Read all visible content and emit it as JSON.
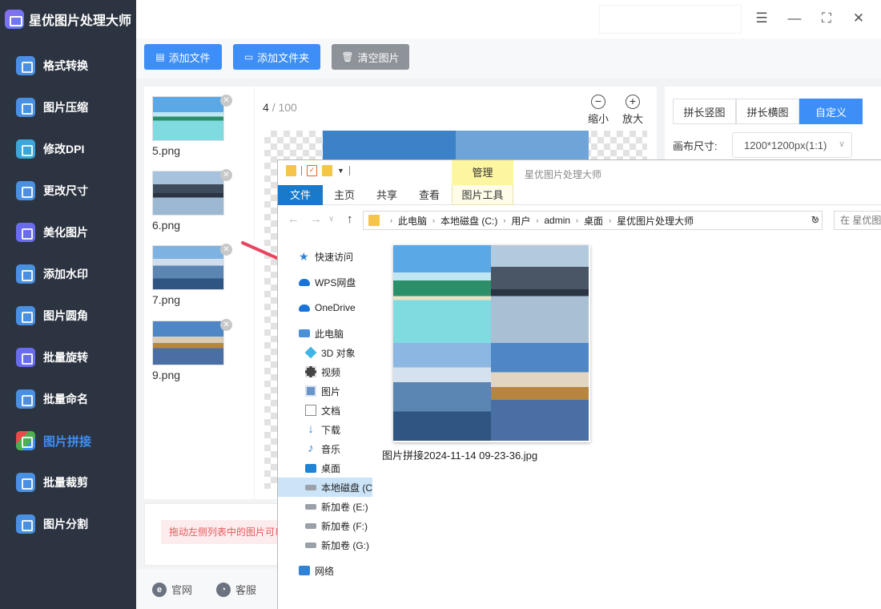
{
  "app": {
    "title": "星优图片处理大师"
  },
  "sidebar": {
    "items": [
      {
        "label": "格式转换"
      },
      {
        "label": "图片压缩"
      },
      {
        "label": "修改DPI"
      },
      {
        "label": "更改尺寸"
      },
      {
        "label": "美化图片"
      },
      {
        "label": "添加水印"
      },
      {
        "label": "图片圆角"
      },
      {
        "label": "批量旋转"
      },
      {
        "label": "批量命名"
      },
      {
        "label": "图片拼接"
      },
      {
        "label": "批量裁剪"
      },
      {
        "label": "图片分割"
      }
    ],
    "active_item": "图片拼接"
  },
  "toolbar": {
    "add_file": "添加文件",
    "add_folder": "添加文件夹",
    "clear": "清空图片"
  },
  "file_list": [
    {
      "name": "5.png"
    },
    {
      "name": "6.png"
    },
    {
      "name": "7.png"
    },
    {
      "name": "9.png"
    }
  ],
  "preview": {
    "current": "4",
    "separator": "/",
    "total": "100",
    "zoom_out": "缩小",
    "zoom_in": "放大"
  },
  "settings": {
    "tabs": [
      "拼长竖图",
      "拼长横图",
      "自定义"
    ],
    "active_tab": "自定义",
    "canvas_label": "画布尺寸:",
    "canvas_value": "1200*1200px(1:1)"
  },
  "hint": {
    "text": "拖动左侧列表中的图片可以"
  },
  "footer": {
    "website": "官网",
    "support": "客服"
  },
  "explorer": {
    "manage_tab": "管理",
    "window_title": "星优图片处理大师",
    "ribbon_tabs": [
      "文件",
      "主页",
      "共享",
      "查看",
      "图片工具"
    ],
    "address": [
      "此电脑",
      "本地磁盘 (C:)",
      "用户",
      "admin",
      "桌面",
      "星优图片处理大师"
    ],
    "search_placeholder": "在 星优图",
    "nav_pane": [
      {
        "label": "快速访问",
        "icon": "star-icon"
      },
      {
        "label": "WPS网盘",
        "icon": "cloud-icon"
      },
      {
        "label": "OneDrive",
        "icon": "onedrive-icon"
      },
      {
        "label": "此电脑",
        "icon": "computer-icon"
      },
      {
        "label": "3D 对象",
        "icon": "cube-icon"
      },
      {
        "label": "视频",
        "icon": "film-icon"
      },
      {
        "label": "图片",
        "icon": "picture-icon"
      },
      {
        "label": "文档",
        "icon": "document-icon"
      },
      {
        "label": "下载",
        "icon": "download-icon"
      },
      {
        "label": "音乐",
        "icon": "music-icon"
      },
      {
        "label": "桌面",
        "icon": "desktop-icon"
      },
      {
        "label": "本地磁盘 (C:)",
        "icon": "drive-icon"
      },
      {
        "label": "新加卷 (E:)",
        "icon": "drive-icon"
      },
      {
        "label": "新加卷 (F:)",
        "icon": "drive-icon"
      },
      {
        "label": "新加卷 (G:)",
        "icon": "drive-icon"
      },
      {
        "label": "网络",
        "icon": "network-icon"
      }
    ],
    "selected_nav": "本地磁盘 (C:)",
    "file_name": "图片拼接2024-11-14 09-23-36.jpg"
  },
  "colors": {
    "accent": "#3d8ef6",
    "sidebar_bg": "#2d3441",
    "arrow": "#e94560",
    "manage_tab": "#fdf5a0",
    "explorer_file_tab": "#1979ca"
  }
}
